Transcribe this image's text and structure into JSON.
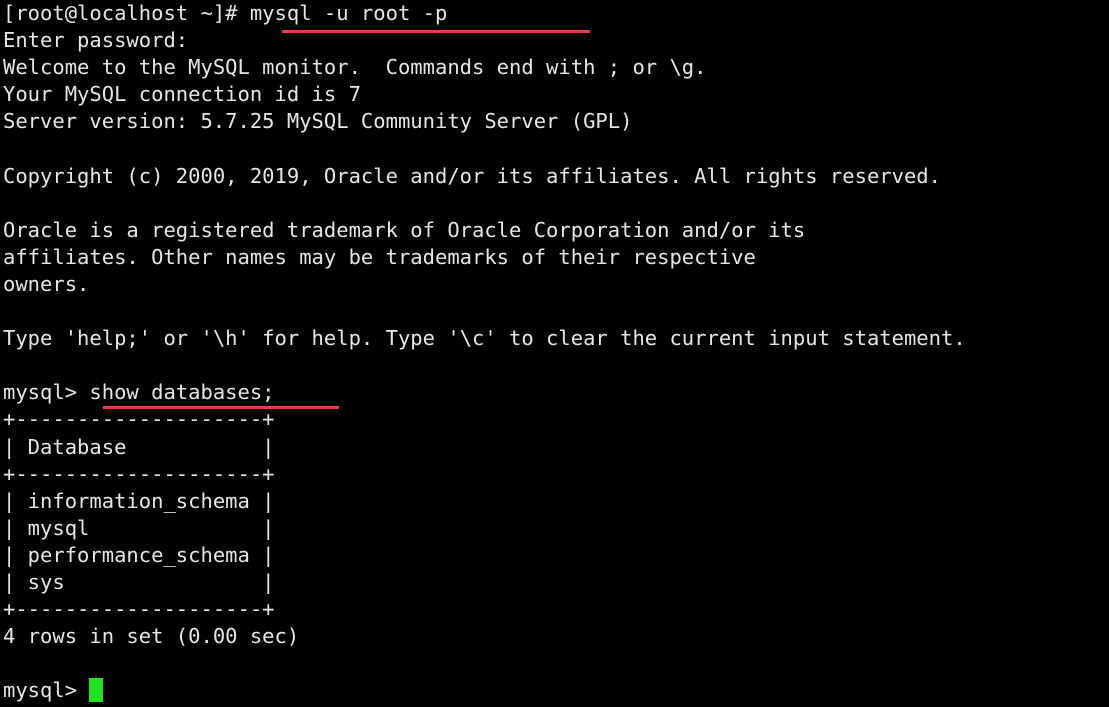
{
  "terminal": {
    "background_color": "#000000",
    "text_color": "#e6e6e6",
    "cursor_color": "#22e022",
    "highlight_color": "#e8404a",
    "lines": [
      {
        "id": "shell-prompt-line",
        "text": "[root@localhost ~]# mysql -u root -p"
      },
      {
        "id": "password-prompt",
        "text": "Enter password:"
      },
      {
        "id": "welcome-line",
        "text": "Welcome to the MySQL monitor.  Commands end with ; or \\g."
      },
      {
        "id": "connection-id-line",
        "text": "Your MySQL connection id is 7"
      },
      {
        "id": "server-version-line",
        "text": "Server version: 5.7.25 MySQL Community Server (GPL)"
      },
      {
        "id": "blank-1",
        "text": ""
      },
      {
        "id": "copyright-line",
        "text": "Copyright (c) 2000, 2019, Oracle and/or its affiliates. All rights reserved."
      },
      {
        "id": "blank-2",
        "text": ""
      },
      {
        "id": "trademark-line-1",
        "text": "Oracle is a registered trademark of Oracle Corporation and/or its"
      },
      {
        "id": "trademark-line-2",
        "text": "affiliates. Other names may be trademarks of their respective"
      },
      {
        "id": "trademark-line-3",
        "text": "owners."
      },
      {
        "id": "blank-3",
        "text": ""
      },
      {
        "id": "help-line",
        "text": "Type 'help;' or '\\h' for help. Type '\\c' to clear the current input statement."
      },
      {
        "id": "blank-4",
        "text": ""
      },
      {
        "id": "mysql-prompt-line",
        "text": "mysql> show databases;"
      },
      {
        "id": "table-top-border",
        "text": "+--------------------+"
      },
      {
        "id": "table-header-row",
        "text": "| Database           |"
      },
      {
        "id": "table-header-separator",
        "text": "+--------------------+"
      },
      {
        "id": "table-row-information-schema",
        "text": "| information_schema |"
      },
      {
        "id": "table-row-mysql",
        "text": "| mysql              |"
      },
      {
        "id": "table-row-performance-schema",
        "text": "| performance_schema |"
      },
      {
        "id": "table-row-sys",
        "text": "| sys                |"
      },
      {
        "id": "table-bottom-border",
        "text": "+--------------------+"
      },
      {
        "id": "rows-summary-line",
        "text": "4 rows in set (0.00 sec)"
      },
      {
        "id": "blank-5",
        "text": ""
      }
    ],
    "final_prompt": "mysql> ",
    "command_typed": "mysql -u root -p",
    "query_typed": "show databases;",
    "shell_prompt": "[root@localhost ~]# ",
    "database_table": {
      "column_header": "Database",
      "values": [
        "information_schema",
        "mysql",
        "performance_schema",
        "sys"
      ],
      "row_count_text": "4 rows in set (0.00 sec)"
    },
    "server_info": {
      "connection_id": "7",
      "version": "5.7.25",
      "edition": "MySQL Community Server (GPL)",
      "copyright_years": "2000, 2019"
    }
  }
}
